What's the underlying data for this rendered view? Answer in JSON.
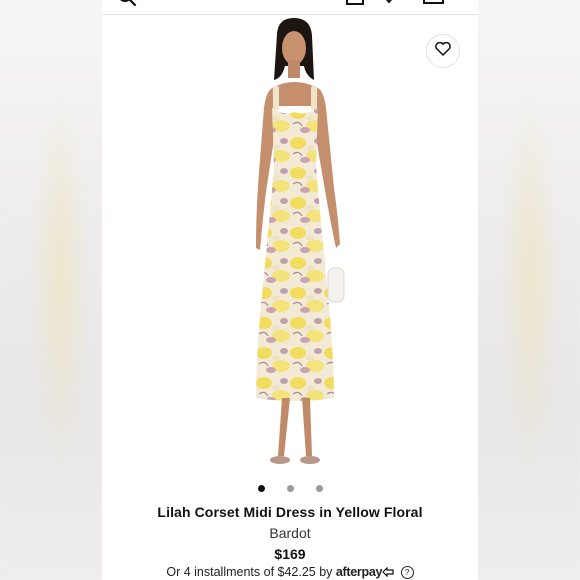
{
  "product": {
    "title": "Lilah Corset Midi Dress in Yellow Floral",
    "brand": "Bardot",
    "price": "$169"
  },
  "payment": {
    "installments_text": "Or 4 installments of $42.25 by",
    "provider_logo": "afterpay",
    "help_symbol": "?"
  },
  "gallery": {
    "image_count": 3,
    "active_index": 0
  },
  "icons": {
    "search": "search-icon",
    "account": "account-icon",
    "wishlist_top": "heart-icon",
    "bag": "bag-icon",
    "wishlist": "heart-outline-icon",
    "afterpay_arrows": "afterpay-arrows-icon",
    "help": "help-circle-icon"
  },
  "colors": {
    "dress_yellow": "#f2dc5e",
    "dress_cream": "#f1e7d2",
    "floral_mauve": "#b892a0",
    "text_primary": "#111111"
  }
}
